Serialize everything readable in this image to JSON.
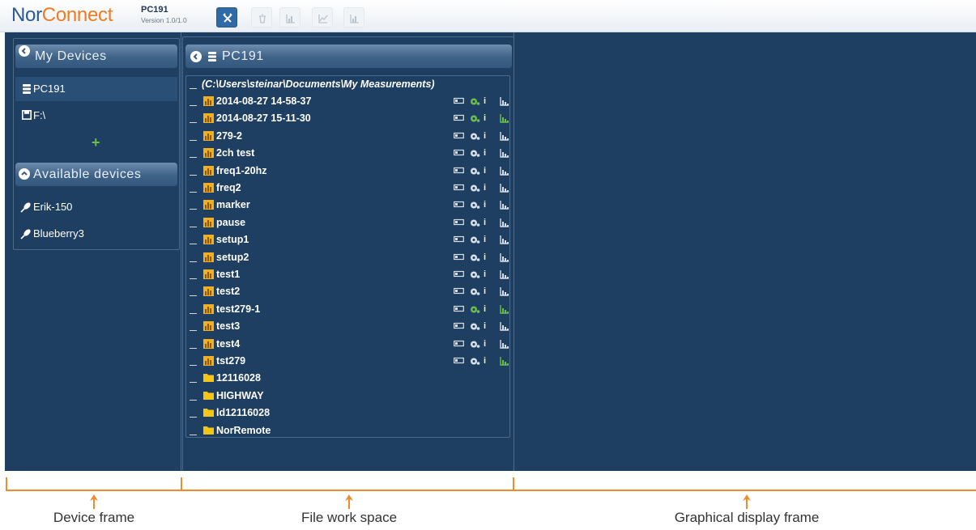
{
  "app": {
    "brand_part1": "Nor",
    "brand_part2": "Connect",
    "device_name": "PC191",
    "version": "Version 1.0/1.0"
  },
  "toolbar": {
    "buttons": [
      {
        "name": "tools-button",
        "icon": "tools-icon",
        "active": true
      },
      {
        "name": "delete-button",
        "icon": "trash-icon",
        "active": false
      },
      {
        "name": "chart-button",
        "icon": "bar-chart-icon",
        "active": false
      },
      {
        "name": "trend-button",
        "icon": "line-chart-icon",
        "active": false
      },
      {
        "name": "report-button",
        "icon": "bar-chart-icon",
        "active": false
      }
    ]
  },
  "device_frame": {
    "my_devices_title": "My Devices",
    "my_devices": [
      {
        "label": "PC191",
        "icon": "server-icon",
        "selected": true
      },
      {
        "label": "F:\\",
        "icon": "floppy-icon",
        "selected": false
      }
    ],
    "add_label": "+",
    "available_title": "Available devices",
    "available": [
      {
        "label": "Erik-150",
        "icon": "plug-icon"
      },
      {
        "label": "Blueberry3",
        "icon": "plug-icon"
      }
    ]
  },
  "workspace": {
    "title": "PC191",
    "path": "(C:\\Users\\steinar\\Documents\\My Measurements)",
    "items": [
      {
        "name": "2014-08-27 14-58-37",
        "type": "measurement",
        "gear_green": true,
        "chart_green": false
      },
      {
        "name": "2014-08-27 15-11-30",
        "type": "measurement",
        "gear_green": true,
        "chart_green": true
      },
      {
        "name": "279-2",
        "type": "measurement",
        "gear_green": false,
        "chart_green": false
      },
      {
        "name": "2ch test",
        "type": "measurement",
        "gear_green": false,
        "chart_green": false
      },
      {
        "name": "freq1-20hz",
        "type": "measurement",
        "gear_green": false,
        "chart_green": false
      },
      {
        "name": "freq2",
        "type": "measurement",
        "gear_green": false,
        "chart_green": false
      },
      {
        "name": "marker",
        "type": "measurement",
        "gear_green": false,
        "chart_green": false
      },
      {
        "name": "pause",
        "type": "measurement",
        "gear_green": false,
        "chart_green": false
      },
      {
        "name": "setup1",
        "type": "measurement",
        "gear_green": false,
        "chart_green": false
      },
      {
        "name": "setup2",
        "type": "measurement",
        "gear_green": false,
        "chart_green": false
      },
      {
        "name": "test1",
        "type": "measurement",
        "gear_green": false,
        "chart_green": false
      },
      {
        "name": "test2",
        "type": "measurement",
        "gear_green": false,
        "chart_green": false
      },
      {
        "name": "test279-1",
        "type": "measurement",
        "gear_green": true,
        "chart_green": true
      },
      {
        "name": "test3",
        "type": "measurement",
        "gear_green": false,
        "chart_green": false
      },
      {
        "name": "test4",
        "type": "measurement",
        "gear_green": false,
        "chart_green": false
      },
      {
        "name": "tst279",
        "type": "measurement",
        "gear_green": false,
        "chart_green": true
      },
      {
        "name": "12116028",
        "type": "folder"
      },
      {
        "name": "HIGHWAY",
        "type": "folder"
      },
      {
        "name": "ld12116028",
        "type": "folder"
      },
      {
        "name": "NorRemote",
        "type": "folder"
      }
    ],
    "info_label": "i"
  },
  "captions": {
    "device_frame": "Device frame",
    "file_work_space": "File work space",
    "graphical_display_frame": "Graphical display frame"
  },
  "colors": {
    "brand_blue": "#2a5a93",
    "brand_orange": "#ef7b22",
    "panel_bg": "#1e3f61",
    "status_green": "#6cc04a",
    "annotation_orange": "#f08a2b",
    "measurement_icon": "#f2b01e",
    "folder_icon": "#f5c518"
  }
}
